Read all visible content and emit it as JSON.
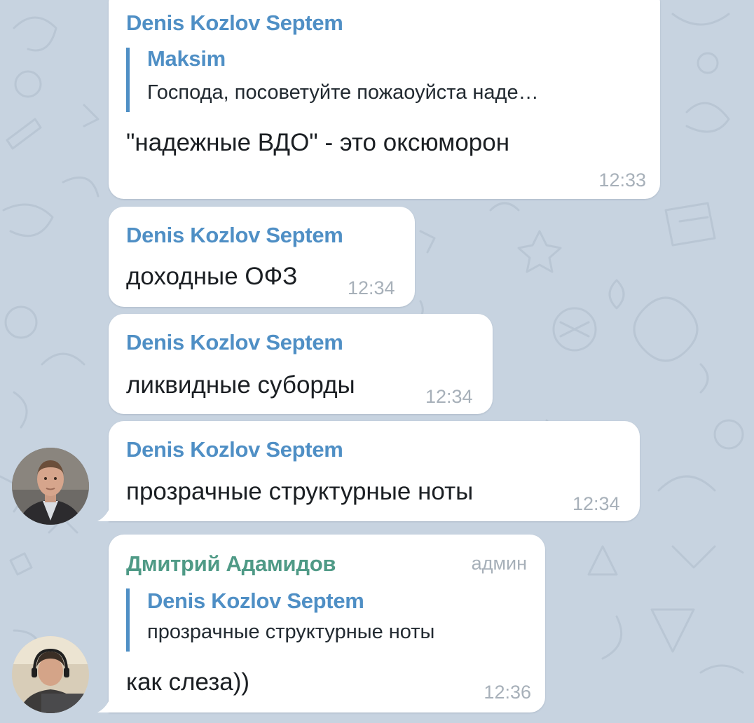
{
  "messages": [
    {
      "sender": "Denis Kozlov Septem",
      "reply": {
        "sender": "Maksim",
        "text": "Господа, посоветуйте пожаоуйста наде…"
      },
      "text": "\"надежные ВДО\" - это оксюморон",
      "time": "12:33"
    },
    {
      "sender": "Denis Kozlov Septem",
      "text": "доходные ОФЗ",
      "time": "12:34"
    },
    {
      "sender": "Denis Kozlov Septem",
      "text": "ликвидные суборды",
      "time": "12:34"
    },
    {
      "sender": "Denis Kozlov Septem",
      "text": "прозрачные структурные ноты",
      "time": "12:34"
    },
    {
      "sender": "Дмитрий Адамидов",
      "admin_label": "админ",
      "reply": {
        "sender": "Denis Kozlov Septem",
        "text": "прозрачные структурные ноты"
      },
      "text": "как слеза))",
      "time": "12:36"
    }
  ],
  "colors": {
    "background": "#c7d3e0",
    "bubble": "#ffffff",
    "sender_blue": "#4f8fc5",
    "sender_green": "#4f9a86",
    "meta_gray": "#a7b0b9"
  }
}
